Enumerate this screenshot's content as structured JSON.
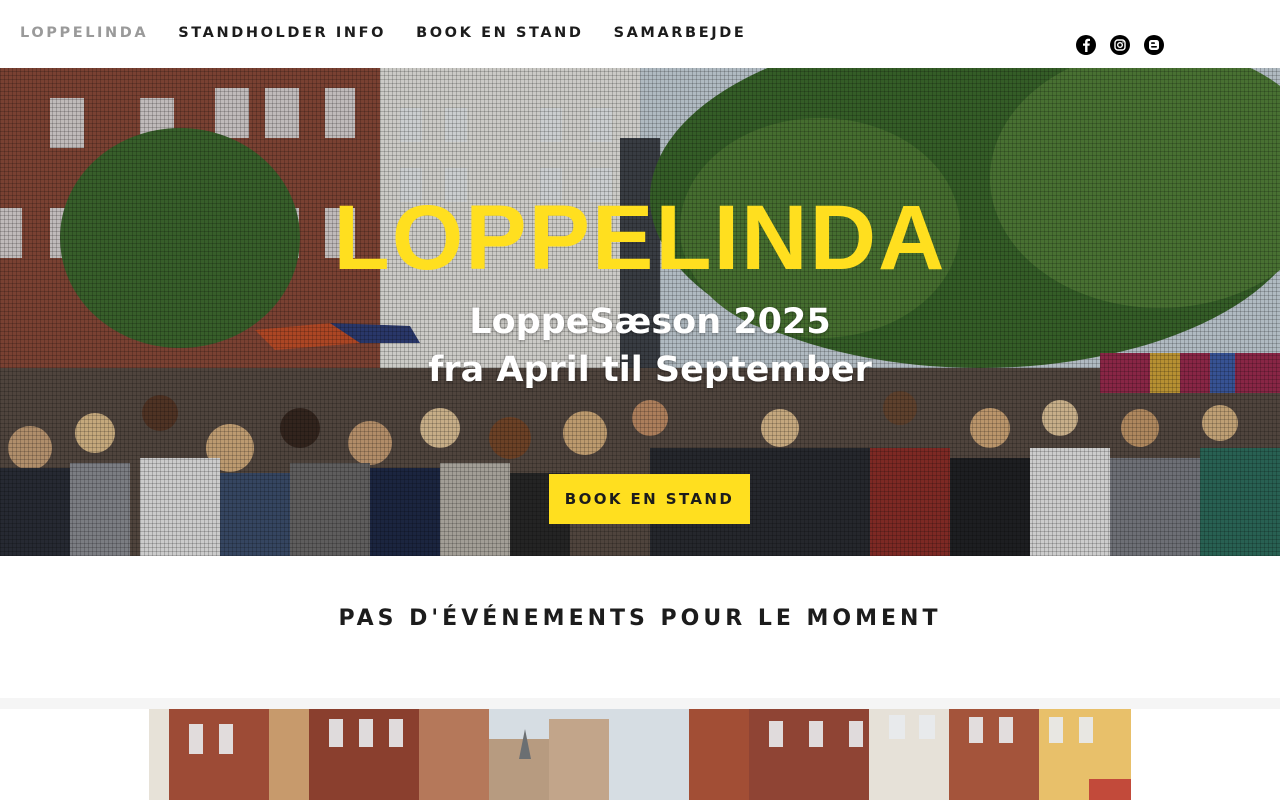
{
  "nav": {
    "items": [
      {
        "label": "LOPPELINDA",
        "active": true
      },
      {
        "label": "STANDHOLDER INFO",
        "active": false
      },
      {
        "label": "BOOK EN STAND",
        "active": false
      },
      {
        "label": "SAMARBEJDE",
        "active": false
      }
    ]
  },
  "socials": [
    {
      "icon": "facebook-icon"
    },
    {
      "icon": "instagram-icon"
    },
    {
      "icon": "blogger-icon"
    }
  ],
  "hero": {
    "title": "LOPPELINDA",
    "subtitle_line1": "LoppeSæson 2025",
    "subtitle_line2": "fra April til September",
    "button_label": "BOOK EN STAND",
    "image": "flea-market-crowd-photo"
  },
  "events": {
    "empty_message": "PAS D'ÉVÉNEMENTS POUR LE MOMENT"
  },
  "gallery": {
    "image": "street-buildings-photo"
  },
  "colors": {
    "accent_yellow": "#ffdf1f",
    "text_dark": "#1c1c1c",
    "nav_active": "#9a9a9a"
  }
}
